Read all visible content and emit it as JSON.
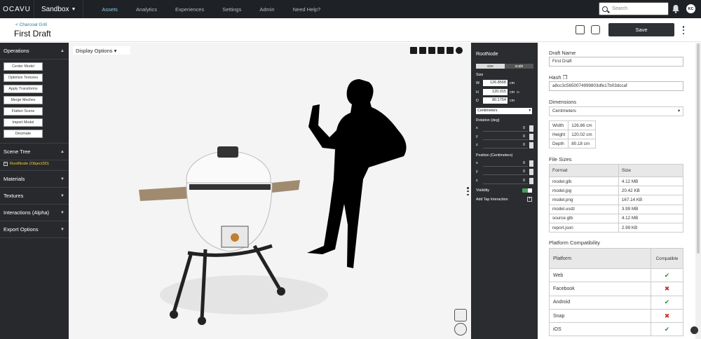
{
  "nav": {
    "brand": "OCAVU",
    "workspace": "Sandbox",
    "links": [
      "Assets",
      "Analytics",
      "Experiences",
      "Settings",
      "Admin",
      "Need Help?"
    ],
    "active": "Assets",
    "search_placeholder": "Search",
    "avatar_initials": "KC"
  },
  "header": {
    "breadcrumb": "< Charcoal Grill",
    "title": "First Draft",
    "save_label": "Save"
  },
  "left": {
    "operations_label": "Operations",
    "operations": [
      "Center Model",
      "Optimize Textures",
      "Apply Transforms",
      "Merge Meshes",
      "Flatten Scene",
      "Import Model",
      "Decimate"
    ],
    "scene_tree_label": "Scene Tree",
    "root_node": "RootNode (Object3D)",
    "sections": [
      "Materials",
      "Textures",
      "Interactions (Alpha)",
      "Export Options"
    ]
  },
  "viewport": {
    "display_options_label": "Display Options"
  },
  "props": {
    "title": "RootNode",
    "toggle": [
      "size",
      "scale"
    ],
    "toggle_active": "scale",
    "size_label": "Size",
    "w": "126.8568",
    "h": "120.015",
    "d": "80.1754",
    "unit": "cm",
    "units_select": "Centimeters",
    "rotation_label": "Rotation (deg)",
    "rot": {
      "x": "0",
      "y": "0",
      "z": "0"
    },
    "position_label": "Position (Centimeters)",
    "pos": {
      "x": "0",
      "y": "0",
      "z": "0"
    },
    "visibility_label": "Visibility",
    "tap_label": "Add Tap Interaction"
  },
  "details": {
    "draft_name_label": "Draft Name",
    "draft_name": "First Draft",
    "hash_label": "Hash",
    "hash": "a8cc3c5650074999803dfe17b03dccaf",
    "dimensions_label": "Dimensions",
    "dimensions_unit": "Centimeters",
    "dims": [
      {
        "k": "Width",
        "v": "126.86 cm"
      },
      {
        "k": "Height",
        "v": "120.02 cm"
      },
      {
        "k": "Depth",
        "v": "80.18 cm"
      }
    ],
    "file_sizes_label": "File Sizes",
    "file_headers": [
      "Format",
      "Size"
    ],
    "files": [
      {
        "format": "model.glb",
        "size": "4.12 MB"
      },
      {
        "format": "model.jpg",
        "size": "20.42 KB"
      },
      {
        "format": "model.png",
        "size": "167.14 KB"
      },
      {
        "format": "model.usdz",
        "size": "3.99 MB"
      },
      {
        "format": "source.glb",
        "size": "4.12 MB"
      },
      {
        "format": "report.json",
        "size": "2.99 KB"
      }
    ],
    "platform_label": "Platform Compatibility",
    "platform_headers": [
      "Platform",
      "Compatible"
    ],
    "platforms": [
      {
        "name": "Web",
        "ok": true
      },
      {
        "name": "Facebook",
        "ok": false
      },
      {
        "name": "Android",
        "ok": true
      },
      {
        "name": "Snap",
        "ok": false
      },
      {
        "name": "iOS",
        "ok": true
      }
    ]
  },
  "colors": {
    "accent": "#8ecae6",
    "dark": "#27292c",
    "yes": "#2e8b3e",
    "no": "#c0392b"
  }
}
